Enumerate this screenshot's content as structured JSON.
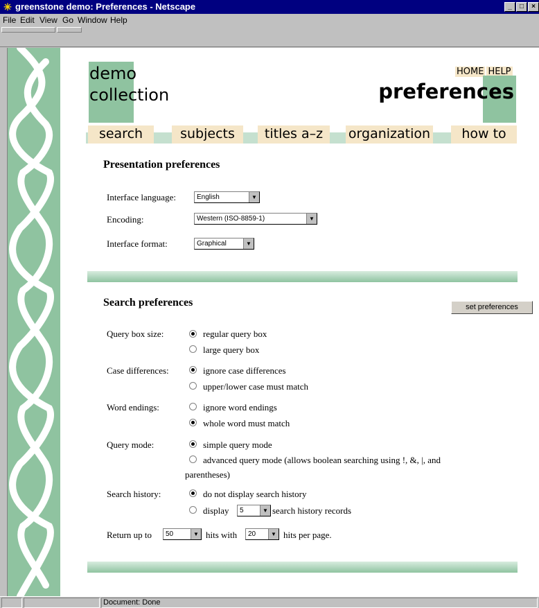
{
  "window": {
    "title": "greenstone demo: Preferences - Netscape",
    "controls": [
      "_",
      "□",
      "×"
    ]
  },
  "menubar": {
    "items": [
      "File",
      "Edit",
      "View",
      "Go",
      "Window",
      "Help"
    ]
  },
  "header": {
    "collection_line1": "demo",
    "collection_line2": "collection",
    "home_link": "HOME",
    "help_link": "HELP",
    "page_title": "preferences"
  },
  "nav": {
    "tabs": [
      "search",
      "subjects",
      "titles a–z",
      "organization",
      "how to"
    ]
  },
  "presentation": {
    "heading": "Presentation preferences",
    "interface_language_label": "Interface language:",
    "interface_language_value": "English",
    "encoding_label": "Encoding:",
    "encoding_value": "Western (ISO-8859-1)",
    "interface_format_label": "Interface format:",
    "interface_format_value": "Graphical"
  },
  "search": {
    "heading": "Search preferences",
    "set_button": "set preferences",
    "query_box_label": "Query box size:",
    "query_box_options": [
      "regular query box",
      "large query box"
    ],
    "case_label": "Case differences:",
    "case_options": [
      "ignore case differences",
      "upper/lower case must match"
    ],
    "word_endings_label": "Word endings:",
    "word_endings_options": [
      "ignore word endings",
      "whole word must match"
    ],
    "query_mode_label": "Query mode:",
    "query_mode_options": [
      "simple query mode",
      "advanced query mode (allows boolean searching using !, &, |, and",
      "parentheses)"
    ],
    "history_label": "Search history:",
    "history_option1": "do not display search history",
    "history_display": "display",
    "history_count": "5",
    "history_records": "search history records",
    "return_up_to": "Return up to",
    "return_value": "50",
    "hits_with": "hits with",
    "per_page_value": "20",
    "hits_per_page": "hits per page."
  },
  "statusbar": {
    "text": "Document: Done"
  },
  "colors": {
    "green": "#8fc3a0",
    "tan": "#f5e6c8",
    "titlebar": "#000080"
  }
}
